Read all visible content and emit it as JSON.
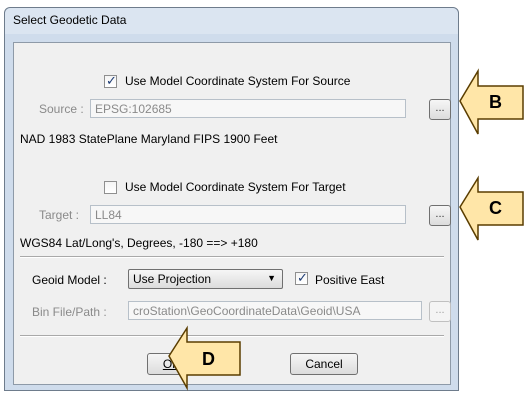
{
  "window": {
    "title": "Select Geodetic Data"
  },
  "source": {
    "use_model_checkbox": {
      "label": "Use Model Coordinate System For Source",
      "checked": true
    },
    "label": "Source :",
    "value": "EPSG:102685",
    "browse_label": "...",
    "description": "NAD 1983 StatePlane Maryland FIPS 1900 Feet"
  },
  "target": {
    "use_model_checkbox": {
      "label": "Use Model Coordinate System For Target",
      "checked": false
    },
    "label": "Target :",
    "value": "LL84",
    "browse_label": "...",
    "description": "WGS84 Lat/Long's, Degrees, -180 ==> +180"
  },
  "geoid": {
    "label": "Geoid Model :",
    "selected": "Use Projection",
    "positive_east": {
      "label": "Positive East",
      "checked": true
    },
    "bin_label": "Bin File/Path :",
    "bin_value": "croStation\\GeoCoordinateData\\Geoid\\USA",
    "bin_browse_label": "..."
  },
  "buttons": {
    "ok": "OK",
    "cancel": "Cancel"
  },
  "callouts": {
    "b": "B",
    "c": "C",
    "d": "D",
    "fill_color": "#ffe6a8",
    "stroke_color": "#5a3d00"
  },
  "colors": {
    "title_bg": "#dbe5f1",
    "frame_bg": "#cfdcec",
    "client_bg": "#f0f0f0",
    "checkmark": "#1d3b74"
  }
}
